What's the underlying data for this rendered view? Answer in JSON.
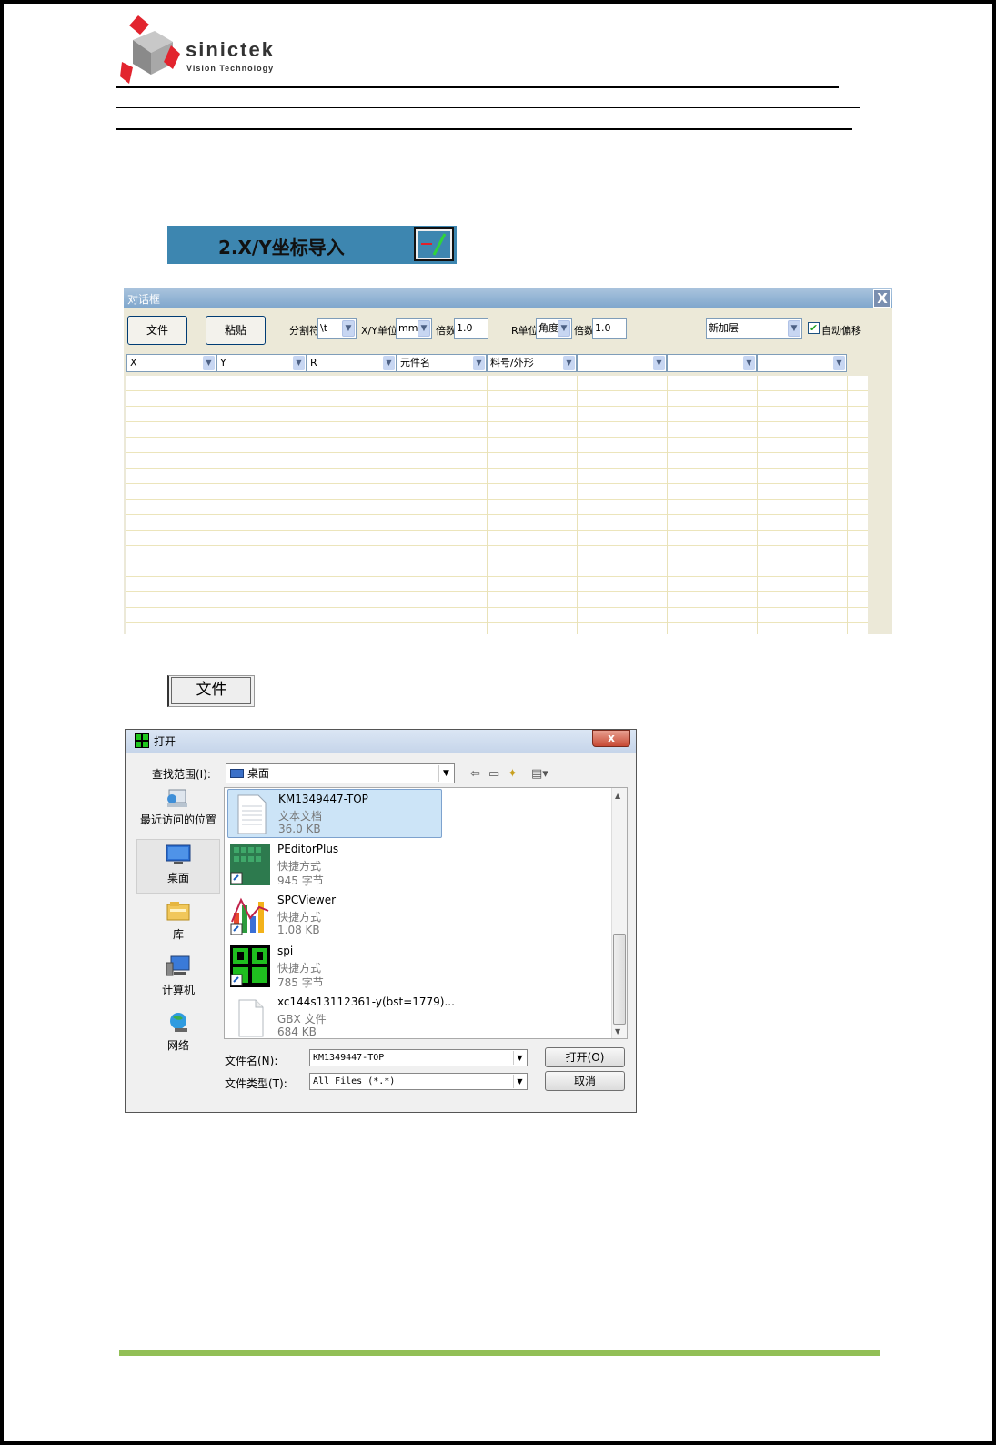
{
  "brand": {
    "name": "sinictek",
    "tagline": "Vision Technology"
  },
  "xy_button": {
    "label": "2.X/Y坐标导入",
    "icon": "xy-import-icon"
  },
  "dialog1": {
    "title": "对话框",
    "close": "X",
    "file_button": "文件",
    "paste_button": "粘贴",
    "separator_label": "分割符",
    "separator_value": "\\t",
    "xy_unit_label": "X/Y单位",
    "xy_unit_value": "mm",
    "multiplier_label": "倍数",
    "multiplier_value": "1.0",
    "r_unit_label": "R单位",
    "r_unit_value": "角度",
    "r_multiplier_label": "倍数",
    "r_multiplier_value": "1.0",
    "layer_value": "新加层",
    "auto_offset_label": "自动偏移",
    "auto_offset_checked": true,
    "columns": [
      "X",
      "Y",
      "R",
      "元件名",
      "料号/外形",
      "",
      "",
      ""
    ]
  },
  "file_button2": {
    "label": "文件"
  },
  "dialog2": {
    "title": "打开",
    "close": "x",
    "look_in_label": "查找范围(I):",
    "look_in_value": "桌面",
    "places": [
      {
        "label": "最近访问的位置",
        "icon": "recent-places-icon"
      },
      {
        "label": "桌面",
        "icon": "desktop-icon"
      },
      {
        "label": "库",
        "icon": "libraries-icon"
      },
      {
        "label": "计算机",
        "icon": "computer-icon"
      },
      {
        "label": "网络",
        "icon": "network-icon"
      }
    ],
    "files": [
      {
        "name": "KM1349447-TOP",
        "type": "文本文档",
        "size": "36.0 KB",
        "icon": "text-document-icon"
      },
      {
        "name": "PEditorPlus",
        "type": "快捷方式",
        "size": "945 字节",
        "icon": "peditorplus-icon"
      },
      {
        "name": "SPCViewer",
        "type": "快捷方式",
        "size": "1.08 KB",
        "icon": "spcviewer-icon"
      },
      {
        "name": "spi",
        "type": "快捷方式",
        "size": "785 字节",
        "icon": "spi-icon"
      },
      {
        "name": "xc144s13112361-y(bst=1779)...",
        "type": "GBX 文件",
        "size": "684 KB",
        "icon": "blank-file-icon"
      }
    ],
    "filename_label": "文件名(N):",
    "filename_value": "KM1349447-TOP",
    "filetype_label": "文件类型(T):",
    "filetype_value": "All Files (*.*)",
    "open_button": "打开(O)",
    "cancel_button": "取消"
  },
  "colors": {
    "accent_blue": "#3d86b0",
    "footer_green": "#92bf56",
    "logo_red": "#e2242e",
    "logo_gray": "#8a8a8a"
  }
}
